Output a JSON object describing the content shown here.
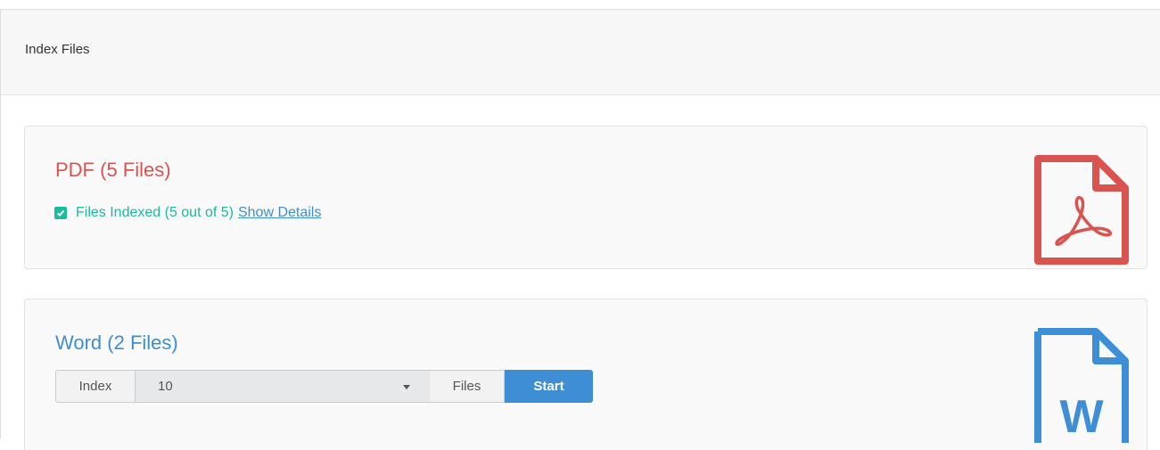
{
  "panel": {
    "title": "Index Files"
  },
  "pdf": {
    "title": "PDF (5 Files)",
    "status_text": "Files Indexed (5 out of 5)",
    "details_link": "Show Details",
    "icon": "pdf-file-icon",
    "color": "#d9534f",
    "status_color": "#1abc9c"
  },
  "word": {
    "title": "Word (2 Files)",
    "index_label": "Index",
    "selected_count": "10",
    "files_label": "Files",
    "start_label": "Start",
    "icon": "word-file-icon",
    "icon_letter": "W",
    "color": "#3d8ed4"
  }
}
